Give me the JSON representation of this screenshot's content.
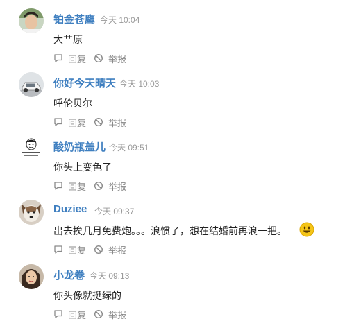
{
  "comments": [
    {
      "user": "铂金苍鹰",
      "time": "今天 10:04",
      "text": "大艹原",
      "reply_label": "回复",
      "report_label": "举报",
      "avatar_icon": "person-avatar-icon"
    },
    {
      "user": "你好今天晴天",
      "time": "今天 10:03",
      "text": "呼伦贝尔",
      "reply_label": "回复",
      "report_label": "举报",
      "avatar_icon": "car-avatar-icon"
    },
    {
      "user": "酸奶瓶盖儿",
      "time": "今天 09:51",
      "text": "你头上变色了",
      "reply_label": "回复",
      "report_label": "举报",
      "avatar_icon": "meme-face-avatar-icon"
    },
    {
      "user": "Duziee",
      "time": "今天 09:37",
      "text": "出去挨几月免费炮。。。浪惯了，想在结婚前再浪一把。",
      "reply_label": "回复",
      "report_label": "举报",
      "avatar_icon": "dog-avatar-icon",
      "emoji_icon": "smile-emoji-icon"
    },
    {
      "user": "小龙卷",
      "time": "今天 09:13",
      "text": "你头像就挺绿的",
      "reply_label": "回复",
      "report_label": "举报",
      "avatar_icon": "person-avatar-icon"
    }
  ],
  "colors": {
    "username": "#3f7fc0",
    "time": "#999999",
    "text": "#222222",
    "action": "#8a8a8a",
    "emoji": "#f5c518"
  }
}
